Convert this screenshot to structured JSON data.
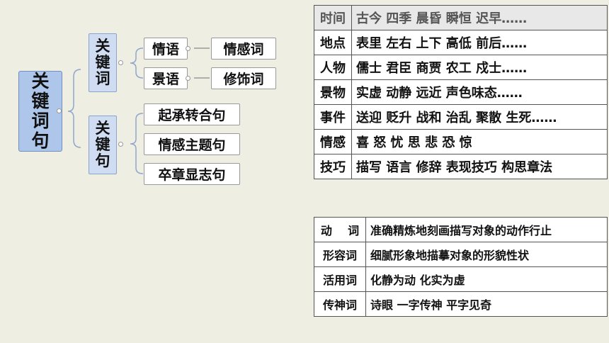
{
  "mindmap": {
    "root": "关键词句",
    "group1": {
      "label": "关键词",
      "children": [
        {
          "label": "情语",
          "target": "情感词"
        },
        {
          "label": "景语",
          "target": "修饰词"
        }
      ]
    },
    "group2": {
      "label": "关键句",
      "children": [
        "起承转合句",
        "情感主题句",
        "卒章显志句"
      ]
    }
  },
  "table1": [
    {
      "head": "时间",
      "content": "古今 四季 晨昏 瞬恒  迟早……"
    },
    {
      "head": "地点",
      "content": "表里 左右 上下 高低 前后……"
    },
    {
      "head": "人物",
      "content": "儒士 君臣 商贾 农工 戍士……"
    },
    {
      "head": "景物",
      "content": "实虚 动静 远近  声色味态……"
    },
    {
      "head": "事件",
      "content": "送迎 贬升 战和 治乱 聚散 生死……"
    },
    {
      "head": "情感",
      "content": "喜 怒 忧 思 悲 恐 惊"
    },
    {
      "head": "技巧",
      "content": "描写 语言 修辞 表现技巧  构思章法"
    }
  ],
  "table2": [
    {
      "head": "动    词",
      "content": "准确精炼地刻画描写对象的动作行止"
    },
    {
      "head": "形容词",
      "content": "细腻形象地描摹对象的形貌性状"
    },
    {
      "head": "活用词",
      "content": "化静为动 化实为虚"
    },
    {
      "head": "传神词",
      "content": "诗眼 一字传神 平字见奇"
    }
  ]
}
